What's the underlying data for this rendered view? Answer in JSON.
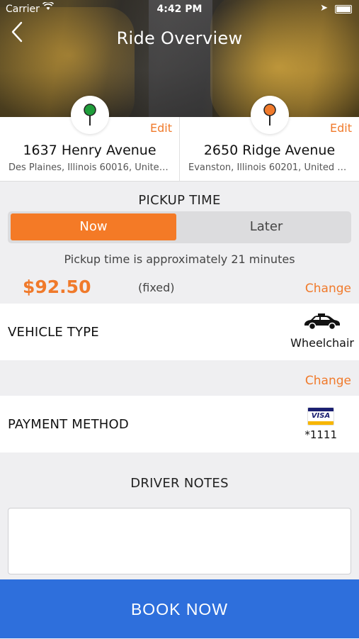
{
  "status_bar": {
    "carrier": "Carrier",
    "time": "4:42 PM"
  },
  "header": {
    "title": "Ride Overview"
  },
  "pickup_location": {
    "edit_label": "Edit",
    "address": "1637 Henry Avenue",
    "detail": "Des Plaines, Illinois 60016, United States",
    "pin_color": "#1f9d3a"
  },
  "dropoff_location": {
    "edit_label": "Edit",
    "address": "2650 Ridge Avenue",
    "detail": "Evanston, Illinois 60201, United States",
    "pin_color": "#f07a2b"
  },
  "pickup_time": {
    "title": "PICKUP TIME",
    "options": [
      "Now",
      "Later"
    ],
    "selected": "Now",
    "eta_text": "Pickup time is approximately 21 minutes"
  },
  "fare": {
    "price": "$92.50",
    "note": "(fixed)",
    "change_label": "Change"
  },
  "vehicle": {
    "label": "VEHICLE TYPE",
    "value": "Wheelchair",
    "icon": "car-icon"
  },
  "payment": {
    "change_label": "Change",
    "label": "PAYMENT METHOD",
    "card_brand": "VISA",
    "card_last4": "*1111"
  },
  "driver_notes": {
    "title": "DRIVER NOTES",
    "value": ""
  },
  "book_button": {
    "label": "BOOK NOW"
  },
  "colors": {
    "accent": "#f47a26",
    "primary": "#2e6fdc",
    "background": "#efeff1"
  }
}
